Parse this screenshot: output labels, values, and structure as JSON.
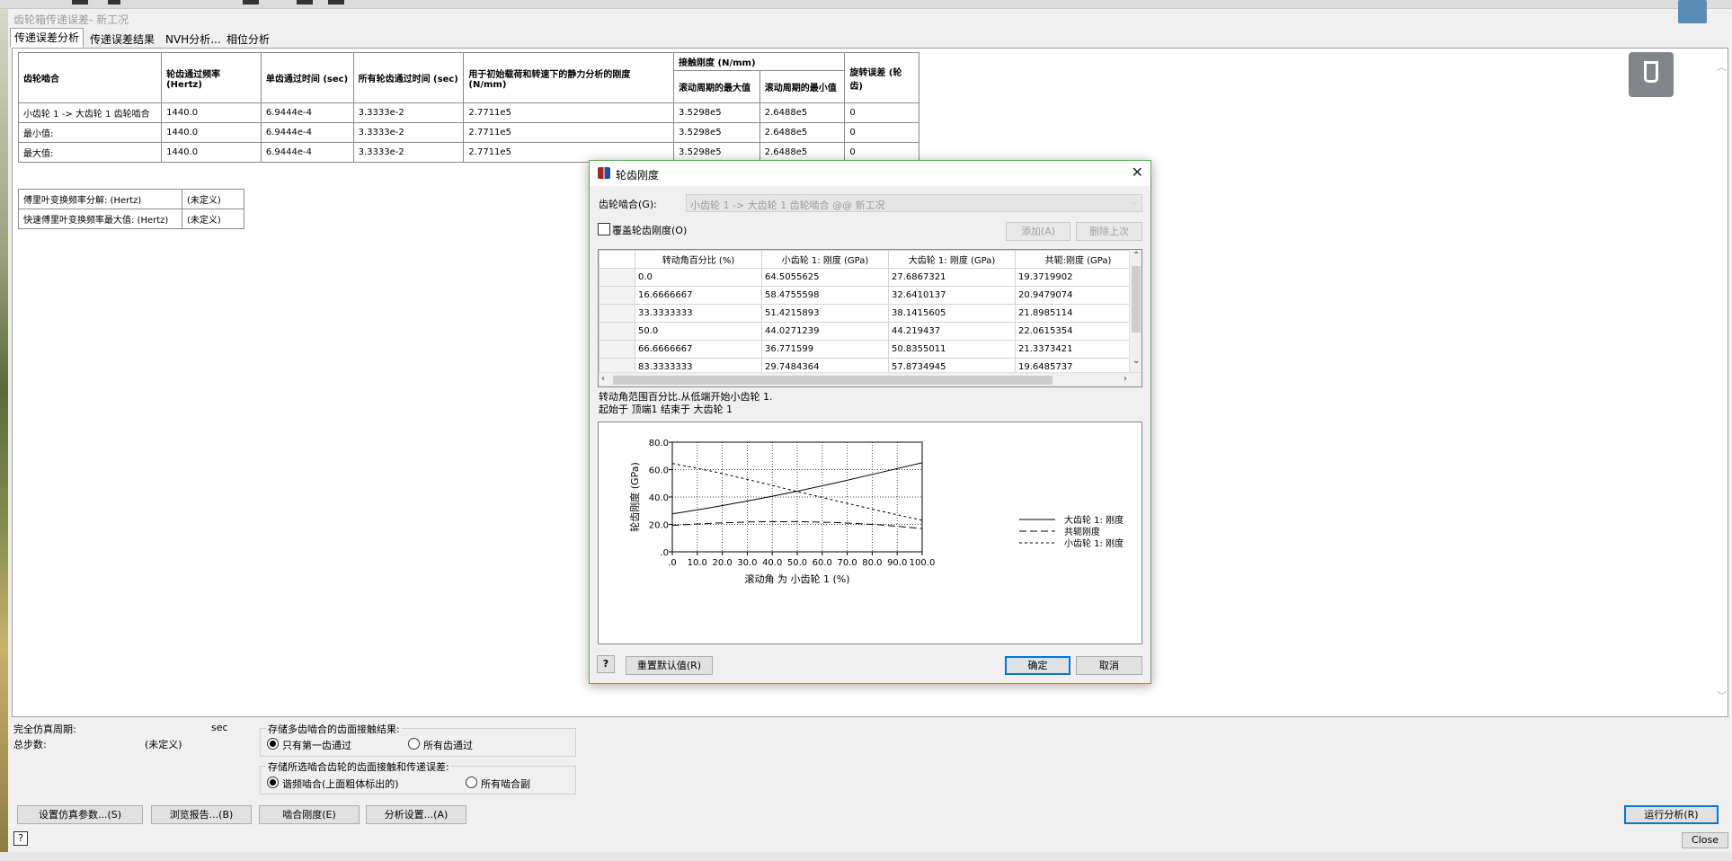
{
  "window": {
    "title": "齿轮箱传递误差- 新工况"
  },
  "tabs": [
    "传递误差分析",
    "传递误差结果",
    "NVH分析...",
    "相位分析"
  ],
  "main_table": {
    "headers": {
      "mesh": "齿轮啮合",
      "freq": "轮齿通过频率 (Hertz)",
      "single": "单齿通过时间 (sec)",
      "all": "所有轮齿通过时间 (sec)",
      "stiffness": "用于初始载荷和转速下的静力分析的刚度 (N/mm)",
      "contact": "接触刚度 (N/mm)",
      "contact_max": "滚动周期的最大值",
      "contact_min": "滚动周期的最小值",
      "rot": "旋转误差 (轮齿)"
    },
    "rows": [
      [
        "小齿轮 1 -> 大齿轮 1 齿轮啮合",
        "1440.0",
        "6.9444e-4",
        "3.3333e-2",
        "2.7711e5",
        "3.5298e5",
        "2.6488e5",
        "0"
      ],
      [
        "最小值:",
        "1440.0",
        "6.9444e-4",
        "3.3333e-2",
        "2.7711e5",
        "3.5298e5",
        "2.6488e5",
        "0"
      ],
      [
        "最大值:",
        "1440.0",
        "6.9444e-4",
        "3.3333e-2",
        "2.7711e5",
        "3.5298e5",
        "2.6488e5",
        "0"
      ]
    ]
  },
  "fft_table": [
    [
      "傅里叶变换频率分解: (Hertz)",
      "(未定义)"
    ],
    [
      "快速傅里叶变换频率最大值: (Hertz)",
      "(未定义)"
    ]
  ],
  "bottom": {
    "period_label": "完全仿真周期:",
    "period_unit": "sec",
    "steps_label": "总步数:",
    "steps_value": "(未定义)",
    "group1_title": "存储多齿啮合的齿面接触结果:",
    "g1_opt1": "只有第一齿通过",
    "g1_opt2": "所有齿通过",
    "group2_title": "存储所选啮合齿轮的齿面接触和传递误差:",
    "g2_opt1": "谐频啮合(上面粗体标出的)",
    "g2_opt2": "所有啮合副",
    "btn_sim": "设置仿真参数...(S)",
    "btn_report": "浏览报告...(B)",
    "btn_mesh": "啮合刚度(E)",
    "btn_analysis": "分析设置...(A)",
    "btn_run": "运行分析(R)",
    "btn_close": "Close",
    "help": "?"
  },
  "dialog": {
    "title": "轮齿刚度",
    "mesh_label": "齿轮啮合(G):",
    "mesh_value": "小齿轮 1 -> 大齿轮 1 齿轮啮合 @@ 新工况",
    "override_label": "覆盖轮齿刚度(O)",
    "add_btn": "添加(A)",
    "delete_btn": "删除上次",
    "columns": [
      "转动角百分比 (%)",
      "小齿轮 1: 刚度 (GPa)",
      "大齿轮 1: 刚度 (GPa)",
      "共轭:刚度 (GPa)"
    ],
    "rows": [
      [
        "0.0",
        "64.5055625",
        "27.6867321",
        "19.3719902"
      ],
      [
        "16.6666667",
        "58.4755598",
        "32.6410137",
        "20.9479074"
      ],
      [
        "33.3333333",
        "51.4215893",
        "38.1415605",
        "21.8985114"
      ],
      [
        "50.0",
        "44.0271239",
        "44.219437",
        "22.0615354"
      ],
      [
        "66.6666667",
        "36.771599",
        "50.8355011",
        "21.3373421"
      ],
      [
        "83.3333333",
        "29.7484364",
        "57.8734945",
        "19.6485737"
      ]
    ],
    "note_line1": "转动角范围百分比.从低端开始小齿轮 1.",
    "note_line2": "起始于 顶端1 结束于 大齿轮 1",
    "reset_btn": "重置默认值(R)",
    "ok_btn": "确定",
    "cancel_btn": "取消",
    "help": "?"
  },
  "chart_data": {
    "type": "line",
    "xlabel": "滚动角 为 小齿轮 1 (%)",
    "ylabel": "轮齿刚度 (GPa)",
    "xlim": [
      0,
      100
    ],
    "ylim": [
      0,
      80
    ],
    "xticks": [
      ".0",
      "10.0",
      "20.0",
      "30.0",
      "40.0",
      "50.0",
      "60.0",
      "70.0",
      "80.0",
      "90.0",
      "100.0"
    ],
    "yticks": [
      ".0",
      "20.0",
      "40.0",
      "60.0",
      "80.0"
    ],
    "grid": true,
    "legend_position": "right",
    "series": [
      {
        "name": "大齿轮 1: 刚度",
        "style": "solid",
        "x": [
          0,
          16.6666667,
          33.3333333,
          50,
          66.6666667,
          83.3333333,
          100
        ],
        "y": [
          27.6867321,
          32.6410137,
          38.1415605,
          44.219437,
          50.8355011,
          57.8734945,
          65.0
        ]
      },
      {
        "name": "共轭刚度",
        "style": "longdash",
        "x": [
          0,
          16.6666667,
          33.3333333,
          50,
          66.6666667,
          83.3333333,
          100
        ],
        "y": [
          19.3719902,
          20.9479074,
          21.8985114,
          22.0615354,
          21.3373421,
          19.6485737,
          17.0
        ]
      },
      {
        "name": "小齿轮 1: 刚度",
        "style": "shortdash",
        "x": [
          0,
          16.6666667,
          33.3333333,
          50,
          66.6666667,
          83.3333333,
          100
        ],
        "y": [
          64.5055625,
          58.4755598,
          51.4215893,
          44.0271239,
          36.771599,
          29.7484364,
          23.0
        ]
      }
    ]
  }
}
